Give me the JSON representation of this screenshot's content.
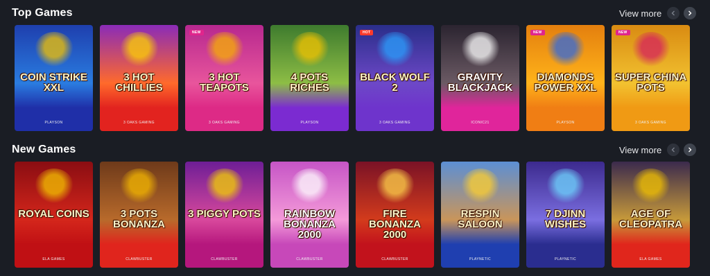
{
  "top_games": {
    "title": "Top Games",
    "view_more": "View more",
    "cards": [
      {
        "title": "Coin Strike XXL",
        "provider": "PLAYSON",
        "badge": "",
        "bg": "#1e3fae",
        "bg2": "#2a7ce0",
        "bottom": "#1f2fa8",
        "accent": "#f5c400"
      },
      {
        "title": "3 Hot Chillies",
        "provider": "3 OAKS GAMING",
        "badge": "",
        "bg": "#8a2bb8",
        "bg2": "#ff6a2b",
        "bottom": "#e2231f",
        "accent": "#ffd400"
      },
      {
        "title": "3 Hot Teapots",
        "provider": "3 OAKS GAMING",
        "badge": "NEW",
        "bg": "#b7288f",
        "bg2": "#e8559c",
        "bottom": "#dd2a86",
        "accent": "#f7b100"
      },
      {
        "title": "4 Pots Riches",
        "provider": "PLAYSON",
        "badge": "",
        "bg": "#3e7b2e",
        "bg2": "#8dbd45",
        "bottom": "#7b2bd1",
        "accent": "#f5c400"
      },
      {
        "title": "Black Wolf 2",
        "provider": "3 OAKS GAMING",
        "badge": "HOT",
        "bg": "#2a2e8a",
        "bg2": "#6d48c7",
        "bottom": "#6e34cc",
        "accent": "#2aa0ff"
      },
      {
        "title": "Gravity Blackjack",
        "provider": "ICONIC21",
        "badge": "",
        "bg": "#2b2430",
        "bg2": "#6b5a64",
        "bottom": "#e0259b",
        "accent": "#ffffff"
      },
      {
        "title": "Diamonds Power XXL",
        "provider": "PLAYSON",
        "badge": "NEW",
        "bg": "#e47f0e",
        "bg2": "#ffb31a",
        "bottom": "#f07e14",
        "accent": "#2e68e0"
      },
      {
        "title": "Super China Pots",
        "provider": "3 OAKS GAMING",
        "badge": "NEW",
        "bg": "#d98b12",
        "bg2": "#f2c230",
        "bottom": "#f09a14",
        "accent": "#d51f5d"
      }
    ]
  },
  "new_games": {
    "title": "New Games",
    "view_more": "View more",
    "cards": [
      {
        "title": "Royal Coins",
        "provider": "ELA GAMES",
        "badge": "",
        "bg": "#8a0d12",
        "bg2": "#d4261b",
        "bottom": "#c01014",
        "accent": "#f5c400"
      },
      {
        "title": "3 Pots Bonanza",
        "provider": "CLAWBUSTER",
        "badge": "",
        "bg": "#6e3a1a",
        "bg2": "#b86a2b",
        "bottom": "#e0251d",
        "accent": "#f5b800"
      },
      {
        "title": "3 Piggy Pots",
        "provider": "CLAWBUSTER",
        "badge": "",
        "bg": "#6e1e96",
        "bg2": "#d8489c",
        "bottom": "#b5177d",
        "accent": "#f5d300"
      },
      {
        "title": "Rainbow Bonanza 2000",
        "provider": "CLAWBUSTER",
        "badge": "",
        "bg": "#c655c6",
        "bg2": "#f49ad9",
        "bottom": "#c748b9",
        "accent": "#ffffff"
      },
      {
        "title": "Fire Bonanza 2000",
        "provider": "CLAWBUSTER",
        "badge": "",
        "bg": "#7a1226",
        "bg2": "#d33b1c",
        "bottom": "#c2121c",
        "accent": "#ffd34a"
      },
      {
        "title": "Respin Saloon",
        "provider": "PLAYNETIC",
        "badge": "",
        "bg": "#5c8fd4",
        "bg2": "#c9955a",
        "bottom": "#1f3fb0",
        "accent": "#ffcf2e"
      },
      {
        "title": "7 Djinn Wishes",
        "provider": "PLAYNETIC",
        "badge": "",
        "bg": "#3c2a8e",
        "bg2": "#7a6ee0",
        "bottom": "#2a2d8f",
        "accent": "#6fd7ff"
      },
      {
        "title": "Age of Cleopatra",
        "provider": "ELA GAMES",
        "badge": "",
        "bg": "#3b2a4d",
        "bg2": "#c79a3a",
        "bottom": "#e0261c",
        "accent": "#f5c400"
      }
    ]
  },
  "colors": {
    "background": "#1a1d24",
    "badge_new": "#e0258c",
    "badge_hot": "#ff3a2c",
    "nav_button": "#2e323b"
  },
  "icons": {
    "prev": "chevron-left-icon",
    "next": "chevron-right-icon"
  }
}
